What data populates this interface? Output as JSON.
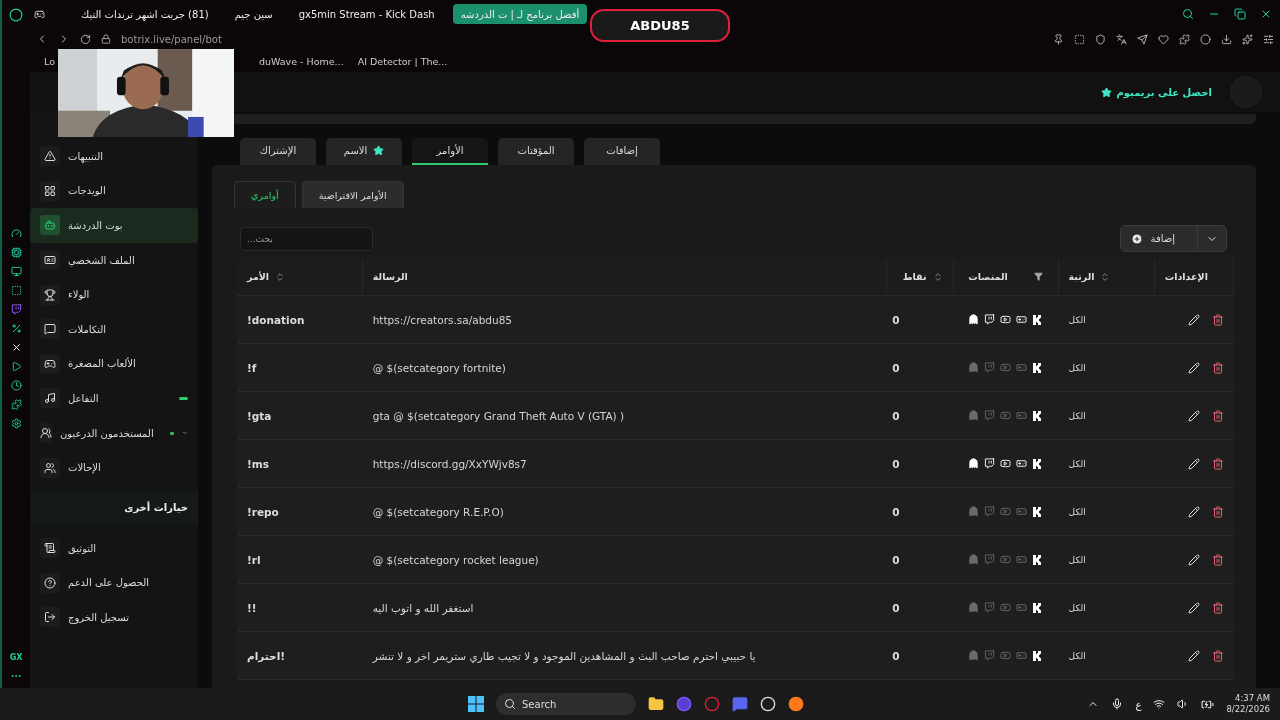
{
  "browser": {
    "tabs": [
      {
        "title": "أفضل برنامج لـ | ت الدردشه",
        "selected": true
      },
      {
        "title": "gx5min Stream - Kick Dash",
        "selected": false
      },
      {
        "title": "سين جيم",
        "selected": false
      },
      {
        "title": "(81) جربت اشهر ترندات التيك",
        "selected": false
      }
    ],
    "address": "botrix.live/panel/bot",
    "bookmarks": [
      "AI Detector | The...",
      "duWave - Home...",
      "Lo"
    ],
    "overlay_name": "ABDU85",
    "gx_label": "GX"
  },
  "header": {
    "premium": "احصل على بريميوم"
  },
  "sidebar": {
    "items": [
      {
        "label": "التنبيهات",
        "selected": false,
        "badge": false,
        "expandable": false
      },
      {
        "label": "الويدجات",
        "selected": false,
        "badge": false,
        "expandable": false
      },
      {
        "label": "بوت الدردشة",
        "selected": true,
        "badge": false,
        "expandable": false
      },
      {
        "label": "الملف الشخصي",
        "selected": false,
        "badge": false,
        "expandable": false
      },
      {
        "label": "الولاء",
        "selected": false,
        "badge": false,
        "expandable": false
      },
      {
        "label": "التكاملات",
        "selected": false,
        "badge": false,
        "expandable": false
      },
      {
        "label": "الألعاب المصغرة",
        "selected": false,
        "badge": false,
        "expandable": false
      },
      {
        "label": "التفاعل",
        "selected": false,
        "badge": true,
        "expandable": false
      },
      {
        "label": "المستخدمون الدرعيون",
        "selected": false,
        "badge": true,
        "expandable": true
      },
      {
        "label": "الإحالات",
        "selected": false,
        "badge": false,
        "expandable": false
      }
    ],
    "section": "خيارات أخرى",
    "other_items": [
      {
        "label": "التوثيق"
      },
      {
        "label": "الحصول على الدعم"
      },
      {
        "label": "تسجيل الخروج"
      }
    ]
  },
  "tabs": [
    {
      "label": "إضافات",
      "selected": false,
      "starred": false
    },
    {
      "label": "المؤقتات",
      "selected": false,
      "starred": false
    },
    {
      "label": "الأوامر",
      "selected": true,
      "starred": false
    },
    {
      "label": "الاسم",
      "selected": false,
      "starred": true
    },
    {
      "label": "الإشتراك",
      "selected": false,
      "starred": false
    }
  ],
  "subtabs": [
    {
      "label": "الأوامر الافتراضية",
      "selected": false
    },
    {
      "label": "أوامري",
      "selected": true
    }
  ],
  "search": {
    "placeholder": "بحث..."
  },
  "add_button": "إضافة",
  "table": {
    "columns": [
      {
        "label": "الإعدادات",
        "sortable": false,
        "filterable": false
      },
      {
        "label": "الرتبة",
        "sortable": true,
        "filterable": false
      },
      {
        "label": "المنصات",
        "sortable": false,
        "filterable": true
      },
      {
        "label": "نقاط",
        "sortable": true,
        "filterable": false
      },
      {
        "label": "الرسالة",
        "sortable": false,
        "filterable": false
      },
      {
        "label": "الأمر",
        "sortable": true,
        "filterable": false
      }
    ],
    "rows": [
      {
        "command": "!donation",
        "message": "https://creators.sa/abdu85",
        "points": "0",
        "platforms": [
          {
            "on": true
          },
          {
            "on": true
          },
          {
            "on": true
          },
          {
            "on": true
          },
          {
            "on": true
          }
        ],
        "rank": "الكل"
      },
      {
        "command": "!f",
        "message": "@ $(setcategory fortnite)",
        "points": "0",
        "platforms": [
          {
            "on": false
          },
          {
            "on": false
          },
          {
            "on": false
          },
          {
            "on": false
          },
          {
            "on": true
          }
        ],
        "rank": "الكل"
      },
      {
        "command": "!gta",
        "message": "gta @ $(setcategory Grand Theft Auto V (GTA) )",
        "points": "0",
        "platforms": [
          {
            "on": false
          },
          {
            "on": false
          },
          {
            "on": false
          },
          {
            "on": false
          },
          {
            "on": true
          }
        ],
        "rank": "الكل"
      },
      {
        "command": "!ms",
        "message": "https://discord.gg/XxYWjv8s7",
        "points": "0",
        "platforms": [
          {
            "on": true
          },
          {
            "on": true
          },
          {
            "on": true
          },
          {
            "on": true
          },
          {
            "on": true
          }
        ],
        "rank": "الكل"
      },
      {
        "command": "!repo",
        "message": "@ $(setcategory R.E.P.O)",
        "points": "0",
        "platforms": [
          {
            "on": false
          },
          {
            "on": false
          },
          {
            "on": false
          },
          {
            "on": false
          },
          {
            "on": true
          }
        ],
        "rank": "الكل"
      },
      {
        "command": "!rl",
        "message": "@ $(setcategory rocket league)",
        "points": "0",
        "platforms": [
          {
            "on": false
          },
          {
            "on": false
          },
          {
            "on": false
          },
          {
            "on": false
          },
          {
            "on": true
          }
        ],
        "rank": "الكل"
      },
      {
        "command": "!!",
        "message": "استغفر الله و اتوب اليه",
        "points": "0",
        "platforms": [
          {
            "on": false
          },
          {
            "on": false
          },
          {
            "on": false
          },
          {
            "on": false
          },
          {
            "on": true
          }
        ],
        "rank": "الكل"
      },
      {
        "command": "احترام!",
        "message": "يا حبيبي احترم صاحب البث و المشاهدين الموجود و لا تجيب طاري ستريمر اخر و لا تنشر",
        "points": "0",
        "platforms": [
          {
            "on": false
          },
          {
            "on": false
          },
          {
            "on": false
          },
          {
            "on": false
          },
          {
            "on": true
          }
        ],
        "rank": "الكل"
      }
    ]
  },
  "taskbar": {
    "search": "Search",
    "keyboard": "ع",
    "time": "4:37 AM",
    "date": "8/22/2026"
  }
}
